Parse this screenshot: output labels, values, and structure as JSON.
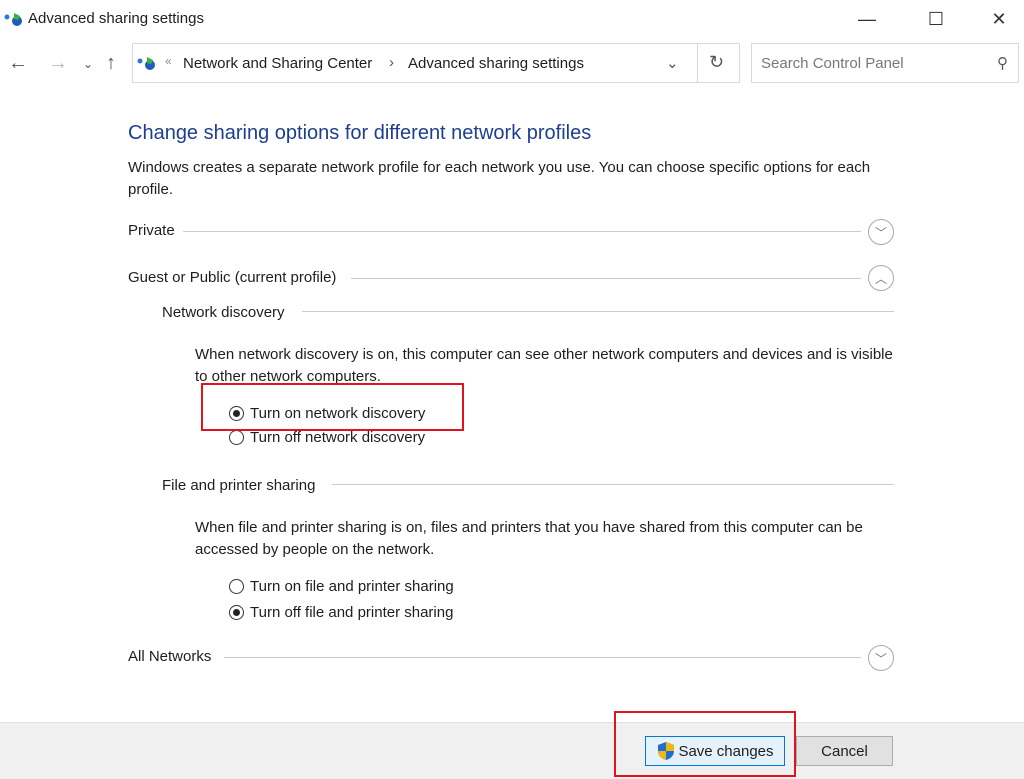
{
  "window": {
    "title": "Advanced sharing settings"
  },
  "address": {
    "crumbs": [
      "Network and Sharing Center",
      "Advanced sharing settings"
    ]
  },
  "search": {
    "placeholder": "Search Control Panel"
  },
  "main": {
    "heading": "Change sharing options for different network profiles",
    "intro": "Windows creates a separate network profile for each network you use. You can choose specific options for each profile.",
    "private": "Private",
    "guest": "Guest or Public (current profile)",
    "discovery": {
      "title": "Network discovery",
      "desc": "When network discovery is on, this computer can see other network computers and devices and is visible to other network computers.",
      "on": "Turn on network discovery",
      "off": "Turn off network discovery",
      "selected": "on"
    },
    "sharing": {
      "title": "File and printer sharing",
      "desc": "When file and printer sharing is on, files and printers that you have shared from this computer can be accessed by people on the network.",
      "on": "Turn on file and printer sharing",
      "off": "Turn off file and printer sharing",
      "selected": "off"
    },
    "all": "All Networks"
  },
  "footer": {
    "save": "Save changes",
    "cancel": "Cancel"
  },
  "colors": {
    "heading": "#1e3f8f",
    "highlight": "#e0141e"
  }
}
